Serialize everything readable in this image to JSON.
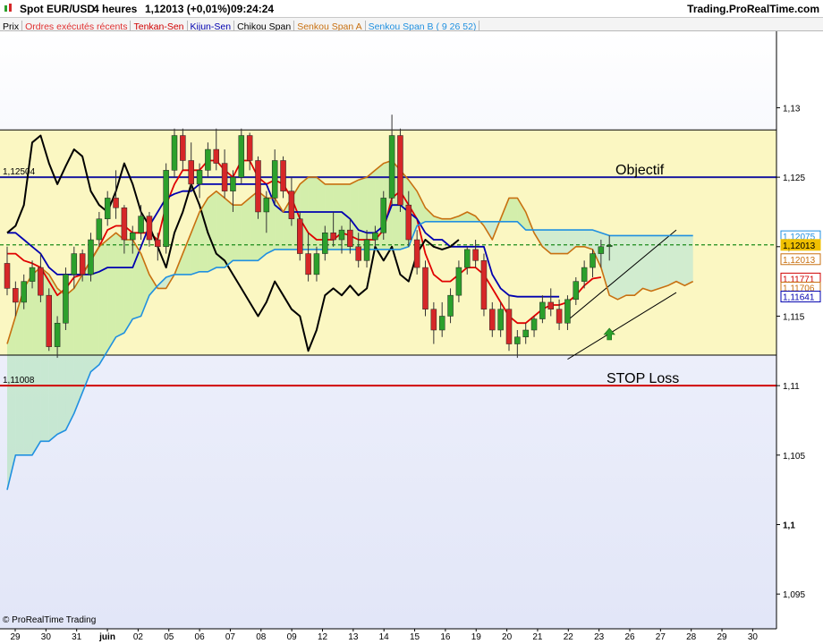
{
  "header": {
    "instrument": "Spot EUR/USD",
    "timeframe": "4 heures",
    "last_quote": "1,12013 (+0,01%)",
    "time": "09:24:24",
    "site": "Trading.ProRealTime.com"
  },
  "legend": [
    {
      "label": "Prix",
      "color": "#000000"
    },
    {
      "label": "Ordres exécutés récents",
      "color": "#e03030"
    },
    {
      "label": "Tenkan-Sen",
      "color": "#d00000"
    },
    {
      "label": "Kijun-Sen",
      "color": "#0000b0"
    },
    {
      "label": "Chikou Span",
      "color": "#000000"
    },
    {
      "label": "Senkou Span A",
      "color": "#c87010"
    },
    {
      "label": "Senkou Span B ( 9 26 52)",
      "color": "#2090e0"
    }
  ],
  "watermark": "© ProRealTime Trading",
  "chart_data": {
    "type": "candlestick",
    "ylim": [
      1.0925,
      1.1355
    ],
    "yaxis_ticks": [
      "1,13",
      "1,125",
      "1,12",
      "1,115",
      "1,11",
      "1,105",
      "1,1",
      "1,095"
    ],
    "yaxis_tick_values": [
      1.13,
      1.125,
      1.12,
      1.115,
      1.11,
      1.105,
      1.1,
      1.095
    ],
    "xaxis_ticks": [
      "29",
      "30",
      "31",
      "juin",
      "02",
      "05",
      "06",
      "07",
      "08",
      "09",
      "12",
      "13",
      "14",
      "15",
      "16",
      "19",
      "20",
      "21",
      "22",
      "23",
      "26",
      "27",
      "28",
      "29",
      "30"
    ],
    "colors": {
      "up": "#2ca02c",
      "down": "#d62728",
      "zone_fill": "#fbf7c2",
      "stop": "#d00000",
      "objective": "#1a1aa0"
    },
    "levels": [
      {
        "name": "Objectif",
        "value": 1.125,
        "label": "1,12504",
        "color": "#1a1aa0"
      },
      {
        "name": "STOP Loss",
        "value": 1.11,
        "label": "1,11008",
        "color": "#d00000"
      }
    ],
    "zone": {
      "top": 1.1284,
      "bottom": 1.1122
    },
    "last_price_line": 1.12013,
    "price_tags": [
      {
        "label": "1,12075",
        "value": 1.12075,
        "color": "#2090e0",
        "filled": false
      },
      {
        "label": "1,12013",
        "value": 1.12013,
        "color": "#f0c000",
        "filled": true
      },
      {
        "label": "1,12013",
        "value": 1.1191,
        "color": "#c87010",
        "filled": false
      },
      {
        "label": "1,11771",
        "value": 1.11771,
        "color": "#d00000",
        "filled": false
      },
      {
        "label": "1,11706",
        "value": 1.11706,
        "color": "#c87010",
        "filled": false
      },
      {
        "label": "1,11641",
        "value": 1.11641,
        "color": "#0000b0",
        "filled": false
      }
    ],
    "candles": [
      [
        1.1188,
        1.12,
        1.1165,
        1.117
      ],
      [
        1.117,
        1.1175,
        1.115,
        1.116
      ],
      [
        1.116,
        1.118,
        1.1155,
        1.1175
      ],
      [
        1.1175,
        1.119,
        1.117,
        1.1185
      ],
      [
        1.1185,
        1.1195,
        1.116,
        1.1165
      ],
      [
        1.1165,
        1.117,
        1.1125,
        1.1128
      ],
      [
        1.1128,
        1.115,
        1.112,
        1.1145
      ],
      [
        1.1145,
        1.1185,
        1.114,
        1.118
      ],
      [
        1.118,
        1.12,
        1.117,
        1.1195
      ],
      [
        1.1195,
        1.1198,
        1.1175,
        1.118
      ],
      [
        1.118,
        1.121,
        1.1175,
        1.1205
      ],
      [
        1.1205,
        1.1225,
        1.12,
        1.122
      ],
      [
        1.122,
        1.124,
        1.1215,
        1.1235
      ],
      [
        1.1235,
        1.1255,
        1.122,
        1.1228
      ],
      [
        1.1228,
        1.123,
        1.1195,
        1.1205
      ],
      [
        1.1205,
        1.1215,
        1.1195,
        1.121
      ],
      [
        1.121,
        1.123,
        1.1205,
        1.1222
      ],
      [
        1.1222,
        1.1225,
        1.12,
        1.1205
      ],
      [
        1.1205,
        1.121,
        1.119,
        1.12
      ],
      [
        1.12,
        1.126,
        1.1195,
        1.1255
      ],
      [
        1.1255,
        1.1285,
        1.125,
        1.128
      ],
      [
        1.128,
        1.1285,
        1.1255,
        1.1262
      ],
      [
        1.1262,
        1.1275,
        1.124,
        1.1245
      ],
      [
        1.1245,
        1.126,
        1.1235,
        1.1255
      ],
      [
        1.1255,
        1.1275,
        1.125,
        1.127
      ],
      [
        1.127,
        1.1285,
        1.1255,
        1.126
      ],
      [
        1.126,
        1.127,
        1.1235,
        1.124
      ],
      [
        1.124,
        1.1255,
        1.1225,
        1.125
      ],
      [
        1.125,
        1.1285,
        1.1245,
        1.128
      ],
      [
        1.128,
        1.1282,
        1.1255,
        1.1262
      ],
      [
        1.1262,
        1.1265,
        1.122,
        1.1225
      ],
      [
        1.1225,
        1.124,
        1.121,
        1.1235
      ],
      [
        1.1235,
        1.127,
        1.123,
        1.1262
      ],
      [
        1.1262,
        1.1265,
        1.1235,
        1.124
      ],
      [
        1.124,
        1.125,
        1.1215,
        1.122
      ],
      [
        1.122,
        1.1225,
        1.119,
        1.1195
      ],
      [
        1.1195,
        1.121,
        1.1175,
        1.118
      ],
      [
        1.118,
        1.12,
        1.1175,
        1.1195
      ],
      [
        1.1195,
        1.1215,
        1.119,
        1.121
      ],
      [
        1.121,
        1.1225,
        1.12,
        1.1205
      ],
      [
        1.1205,
        1.1215,
        1.1195,
        1.1212
      ],
      [
        1.1212,
        1.122,
        1.1195,
        1.12
      ],
      [
        1.12,
        1.121,
        1.1185,
        1.119
      ],
      [
        1.119,
        1.1212,
        1.1185,
        1.1205
      ],
      [
        1.1205,
        1.1215,
        1.12,
        1.121
      ],
      [
        1.121,
        1.124,
        1.1205,
        1.1235
      ],
      [
        1.1235,
        1.1295,
        1.123,
        1.128
      ],
      [
        1.128,
        1.1285,
        1.1225,
        1.123
      ],
      [
        1.123,
        1.124,
        1.12,
        1.1205
      ],
      [
        1.1205,
        1.1212,
        1.118,
        1.1185
      ],
      [
        1.1185,
        1.119,
        1.115,
        1.1155
      ],
      [
        1.1155,
        1.116,
        1.113,
        1.114
      ],
      [
        1.114,
        1.116,
        1.1135,
        1.115
      ],
      [
        1.115,
        1.117,
        1.1145,
        1.1165
      ],
      [
        1.1165,
        1.119,
        1.116,
        1.1185
      ],
      [
        1.1185,
        1.12,
        1.118,
        1.1198
      ],
      [
        1.1198,
        1.1205,
        1.1185,
        1.119
      ],
      [
        1.119,
        1.1195,
        1.115,
        1.1155
      ],
      [
        1.1155,
        1.116,
        1.1135,
        1.114
      ],
      [
        1.114,
        1.116,
        1.1135,
        1.1155
      ],
      [
        1.1155,
        1.1165,
        1.1125,
        1.113
      ],
      [
        1.113,
        1.114,
        1.112,
        1.1135
      ],
      [
        1.1135,
        1.1145,
        1.113,
        1.114
      ],
      [
        1.114,
        1.115,
        1.1135,
        1.1148
      ],
      [
        1.1148,
        1.1165,
        1.1145,
        1.116
      ],
      [
        1.116,
        1.117,
        1.115,
        1.1155
      ],
      [
        1.1155,
        1.1162,
        1.114,
        1.1145
      ],
      [
        1.1145,
        1.1165,
        1.114,
        1.1162
      ],
      [
        1.1162,
        1.1178,
        1.1158,
        1.1175
      ],
      [
        1.1175,
        1.119,
        1.117,
        1.1185
      ],
      [
        1.1185,
        1.1198,
        1.1178,
        1.1195
      ],
      [
        1.1195,
        1.1205,
        1.1185,
        1.12
      ],
      [
        1.12,
        1.1208,
        1.119,
        1.1201
      ]
    ],
    "series": [
      {
        "name": "Tenkan-Sen",
        "color": "#e00000",
        "values": [
          1.1195,
          1.1195,
          1.119,
          1.1188,
          1.1185,
          1.1175,
          1.1165,
          1.117,
          1.1178,
          1.118,
          1.119,
          1.12,
          1.1212,
          1.1215,
          1.1215,
          1.121,
          1.121,
          1.121,
          1.1205,
          1.123,
          1.1245,
          1.1255,
          1.1255,
          1.1255,
          1.1262,
          1.1262,
          1.1255,
          1.125,
          1.1262,
          1.1262,
          1.125,
          1.1245,
          1.1248,
          1.1245,
          1.1235,
          1.122,
          1.121,
          1.1205,
          1.1205,
          1.1205,
          1.121,
          1.1208,
          1.1205,
          1.1205,
          1.1205,
          1.1212,
          1.1235,
          1.124,
          1.123,
          1.122,
          1.1195,
          1.118,
          1.1175,
          1.1175,
          1.118,
          1.1185,
          1.1185,
          1.118,
          1.117,
          1.116,
          1.115,
          1.1145,
          1.1145,
          1.115,
          1.1155,
          1.1158,
          1.1158,
          1.116,
          1.1165,
          1.1172,
          1.1177,
          1.1178,
          null,
          null,
          null,
          null
        ]
      },
      {
        "name": "Kijun-Sen",
        "color": "#0000b0",
        "values": [
          1.121,
          1.121,
          1.1205,
          1.12,
          1.1195,
          1.1185,
          1.118,
          1.118,
          1.118,
          1.118,
          1.118,
          1.1182,
          1.1185,
          1.1185,
          1.1185,
          1.1185,
          1.12,
          1.1215,
          1.1225,
          1.1235,
          1.1238,
          1.124,
          1.124,
          1.1245,
          1.1245,
          1.1245,
          1.1245,
          1.1245,
          1.1245,
          1.1245,
          1.1245,
          1.1245,
          1.123,
          1.1225,
          1.1225,
          1.1225,
          1.1225,
          1.1225,
          1.1225,
          1.1225,
          1.1225,
          1.122,
          1.1212,
          1.121,
          1.121,
          1.1215,
          1.123,
          1.123,
          1.1225,
          1.122,
          1.121,
          1.1205,
          1.1205,
          1.12,
          1.12,
          1.12,
          1.12,
          1.12,
          1.118,
          1.117,
          1.1165,
          1.1164,
          1.1164,
          1.1164,
          1.1164,
          1.1164,
          1.1164,
          null,
          null,
          null,
          null,
          null,
          null,
          null,
          null,
          null
        ]
      },
      {
        "name": "Chikou Span",
        "color": "#000000",
        "values": [
          1.121,
          1.1215,
          1.123,
          1.1275,
          1.128,
          1.126,
          1.1245,
          1.1258,
          1.127,
          1.1265,
          1.124,
          1.123,
          1.1225,
          1.124,
          1.126,
          1.1245,
          1.1225,
          1.1215,
          1.12,
          1.1185,
          1.121,
          1.1225,
          1.1245,
          1.123,
          1.121,
          1.1195,
          1.119,
          1.118,
          1.117,
          1.116,
          1.115,
          1.116,
          1.1175,
          1.1165,
          1.1155,
          1.115,
          1.1125,
          1.114,
          1.1165,
          1.117,
          1.1165,
          1.1172,
          1.1165,
          1.117,
          1.12,
          1.119,
          1.12,
          1.118,
          1.1175,
          1.1195,
          1.1205,
          1.12,
          1.1198,
          1.12,
          1.1205,
          null,
          null,
          null,
          null,
          null,
          null,
          null,
          null,
          null,
          null,
          null,
          null,
          null,
          null,
          null,
          null,
          null,
          null,
          null,
          null,
          null,
          null,
          null,
          null,
          null,
          null,
          null,
          null,
          null,
          null,
          null,
          null
        ]
      },
      {
        "name": "Senkou Span A",
        "color": "#c87010",
        "values": [
          1.113,
          1.115,
          1.117,
          1.118,
          1.1185,
          1.118,
          1.117,
          1.1165,
          1.117,
          1.118,
          1.119,
          1.12,
          1.1205,
          1.121,
          1.1205,
          1.1205,
          1.1195,
          1.118,
          1.117,
          1.117,
          1.118,
          1.1195,
          1.121,
          1.1225,
          1.1235,
          1.124,
          1.1235,
          1.123,
          1.123,
          1.1235,
          1.124,
          1.1235,
          1.1235,
          1.1225,
          1.1235,
          1.1245,
          1.125,
          1.125,
          1.1245,
          1.1245,
          1.1245,
          1.1245,
          1.1248,
          1.125,
          1.1255,
          1.126,
          1.1262,
          1.1255,
          1.1248,
          1.124,
          1.1228,
          1.1222,
          1.122,
          1.122,
          1.1222,
          1.1225,
          1.1222,
          1.1215,
          1.1205,
          1.122,
          1.1235,
          1.1235,
          1.1225,
          1.121,
          1.12,
          1.1195,
          1.1195,
          1.1195,
          1.12,
          1.12,
          1.1198,
          1.1185,
          1.1165,
          1.1162,
          1.1165,
          1.1165,
          1.117,
          1.1168,
          1.117,
          1.1172,
          1.1175,
          1.1172,
          1.1175
        ]
      },
      {
        "name": "Senkou Span B ( 9 26 52)",
        "color": "#2090e0",
        "values": [
          1.1025,
          1.105,
          1.105,
          1.105,
          1.106,
          1.106,
          1.1065,
          1.1068,
          1.108,
          1.1095,
          1.111,
          1.1115,
          1.1125,
          1.1135,
          1.1138,
          1.1148,
          1.115,
          1.1165,
          1.1172,
          1.1178,
          1.118,
          1.118,
          1.118,
          1.1182,
          1.1182,
          1.1185,
          1.1185,
          1.119,
          1.119,
          1.119,
          1.119,
          1.1195,
          1.1198,
          1.1198,
          1.1198,
          1.1198,
          1.1198,
          1.1198,
          1.1198,
          1.1198,
          1.1198,
          1.1198,
          1.1198,
          1.1198,
          1.1198,
          1.1198,
          1.1198,
          1.1198,
          1.12,
          1.1215,
          1.1218,
          1.1218,
          1.1218,
          1.1218,
          1.1218,
          1.1218,
          1.1218,
          1.1218,
          1.1218,
          1.1218,
          1.1218,
          1.1218,
          1.1212,
          1.1212,
          1.1212,
          1.1212,
          1.1212,
          1.1212,
          1.1212,
          1.1212,
          1.1212,
          1.121,
          1.1208,
          1.1208,
          1.1208,
          1.1208,
          1.1208,
          1.1208,
          1.1208,
          1.1208,
          1.1208,
          1.1208,
          1.1208
        ]
      }
    ],
    "channel": {
      "upper": [
        [
          67,
          1.1147
        ],
        [
          80,
          1.1212
        ]
      ],
      "lower": [
        [
          67,
          1.1119
        ],
        [
          80,
          1.1167
        ]
      ]
    },
    "arrow_index": 72
  }
}
